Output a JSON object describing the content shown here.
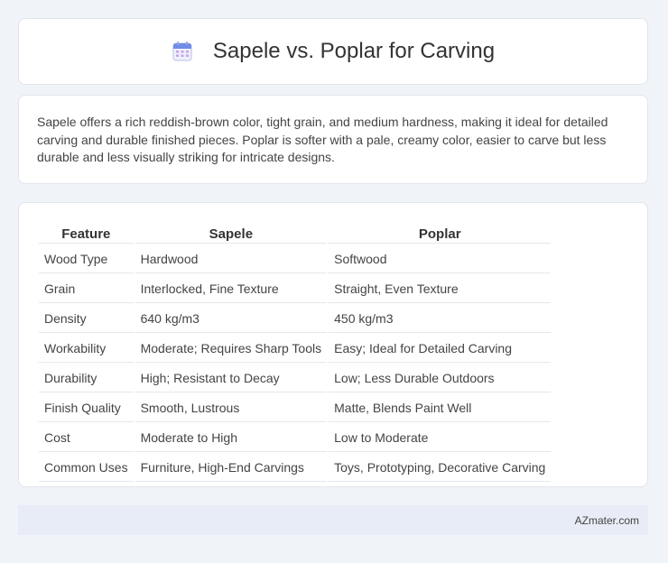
{
  "header": {
    "title": "Sapele vs. Poplar for Carving",
    "icon": "calendar-icon"
  },
  "summary": {
    "text": "Sapele offers a rich reddish-brown color, tight grain, and medium hardness, making it ideal for detailed carving and durable finished pieces. Poplar is softer with a pale, creamy color, easier to carve but less durable and less visually striking for intricate designs."
  },
  "table": {
    "headers": [
      "Feature",
      "Sapele",
      "Poplar"
    ],
    "rows": [
      [
        "Wood Type",
        "Hardwood",
        "Softwood"
      ],
      [
        "Grain",
        "Interlocked, Fine Texture",
        "Straight, Even Texture"
      ],
      [
        "Density",
        "640 kg/m3",
        "450 kg/m3"
      ],
      [
        "Workability",
        "Moderate; Requires Sharp Tools",
        "Easy; Ideal for Detailed Carving"
      ],
      [
        "Durability",
        "High; Resistant to Decay",
        "Low; Less Durable Outdoors"
      ],
      [
        "Finish Quality",
        "Smooth, Lustrous",
        "Matte, Blends Paint Well"
      ],
      [
        "Cost",
        "Moderate to High",
        "Low to Moderate"
      ],
      [
        "Common Uses",
        "Furniture, High-End Carvings",
        "Toys, Prototyping, Decorative Carving"
      ]
    ]
  },
  "footer": {
    "brand": "AZmater.com"
  },
  "colors": {
    "background": "#f0f3f8",
    "card": "#ffffff",
    "footer": "#e7ecf6",
    "icon_accent": "#8e6fd8"
  }
}
